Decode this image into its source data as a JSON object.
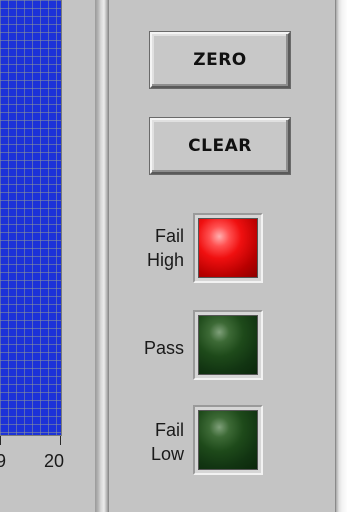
{
  "graph": {
    "x_ticks": [
      {
        "label": "9"
      },
      {
        "label": "20"
      }
    ]
  },
  "controls": {
    "zero_label": "ZERO",
    "clear_label": "CLEAR"
  },
  "indicators": [
    {
      "label_line1": "Fail",
      "label_line2": "High",
      "state": "on",
      "color": "#ff2020"
    },
    {
      "label_line1": "Pass",
      "label_line2": "",
      "state": "off",
      "color": "#1e4a1a"
    },
    {
      "label_line1": "Fail",
      "label_line2": "Low",
      "state": "off",
      "color": "#1e4a1a"
    }
  ],
  "colors": {
    "plot_background": "#1c32d8",
    "panel": "#c4c4c4"
  }
}
